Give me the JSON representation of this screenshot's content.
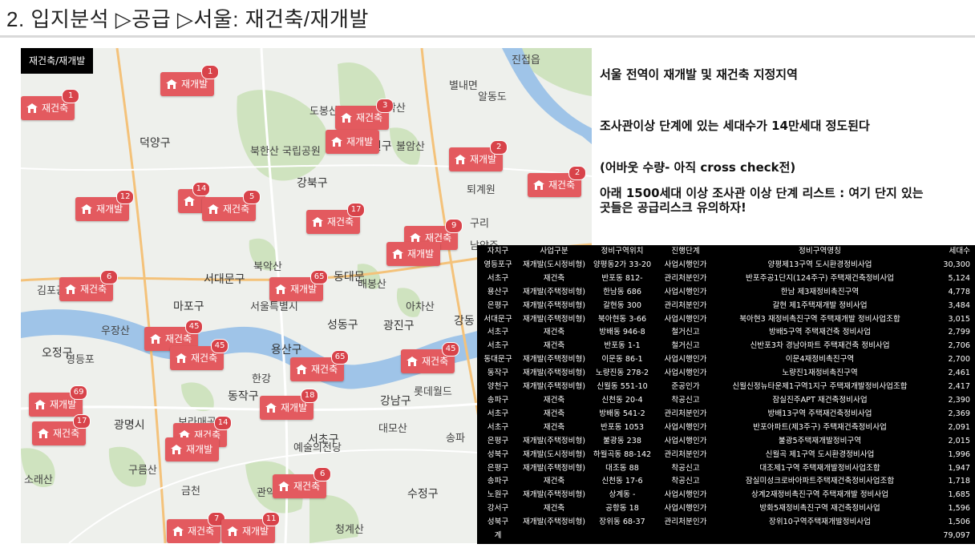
{
  "slide": {
    "title": "2. 입지분석 ▷공급 ▷서울: 재건축/재개발"
  },
  "map": {
    "label": "재건축/재개발",
    "districts": [
      {
        "name": "강북구",
        "cls": "big"
      },
      {
        "name": "노원구",
        "cls": "big"
      },
      {
        "name": "서대문구",
        "cls": "big"
      },
      {
        "name": "마포구",
        "cls": "big"
      },
      {
        "name": "성동구",
        "cls": "big"
      },
      {
        "name": "광진구",
        "cls": "big"
      },
      {
        "name": "용산구",
        "cls": "big"
      },
      {
        "name": "동작구",
        "cls": "big"
      },
      {
        "name": "강남구",
        "cls": "big"
      },
      {
        "name": "광명시",
        "cls": "big"
      },
      {
        "name": "오정구",
        "cls": "big"
      },
      {
        "name": "덕양구",
        "cls": "big"
      },
      {
        "name": "동대문",
        "cls": "big"
      },
      {
        "name": "서초구",
        "cls": "big"
      },
      {
        "name": "수정구",
        "cls": "big"
      },
      {
        "name": "강동",
        "cls": "big"
      },
      {
        "name": "북한산 국립공원",
        "cls": ""
      },
      {
        "name": "수락산",
        "cls": ""
      },
      {
        "name": "불암산",
        "cls": ""
      },
      {
        "name": "도봉산",
        "cls": ""
      },
      {
        "name": "별내면",
        "cls": ""
      },
      {
        "name": "진접읍",
        "cls": ""
      },
      {
        "name": "알동도",
        "cls": ""
      },
      {
        "name": "퇴계원",
        "cls": ""
      },
      {
        "name": "남양주",
        "cls": ""
      },
      {
        "name": "구리",
        "cls": ""
      },
      {
        "name": "아차산",
        "cls": ""
      },
      {
        "name": "배봉산",
        "cls": ""
      },
      {
        "name": "북악산",
        "cls": ""
      },
      {
        "name": "우장산",
        "cls": ""
      },
      {
        "name": "김포공",
        "cls": ""
      },
      {
        "name": "롯데월드",
        "cls": ""
      },
      {
        "name": "예술의전당",
        "cls": ""
      },
      {
        "name": "관악산",
        "cls": ""
      },
      {
        "name": "청계산",
        "cls": ""
      },
      {
        "name": "구름산",
        "cls": ""
      },
      {
        "name": "소래산",
        "cls": ""
      },
      {
        "name": "보라매공원",
        "cls": ""
      },
      {
        "name": "대모산",
        "cls": ""
      },
      {
        "name": "송파",
        "cls": ""
      },
      {
        "name": "서울특별시",
        "cls": ""
      },
      {
        "name": "한강",
        "cls": ""
      },
      {
        "name": "영등포",
        "cls": ""
      },
      {
        "name": "신림",
        "cls": ""
      },
      {
        "name": "금천",
        "cls": ""
      }
    ],
    "markers": [
      {
        "label": "재개발",
        "count": "1"
      },
      {
        "label": "재건축",
        "count": "1"
      },
      {
        "label": "재건축",
        "count": "3"
      },
      {
        "label": "재개발",
        "count": ""
      },
      {
        "label": "재개발",
        "count": "2"
      },
      {
        "label": "재건축",
        "count": "2"
      },
      {
        "label": "재개발",
        "count": "12"
      },
      {
        "label": "",
        "count": "14"
      },
      {
        "label": "재건축",
        "count": "5"
      },
      {
        "label": "재건축",
        "count": "17"
      },
      {
        "label": "재건축",
        "count": "9"
      },
      {
        "label": "재개발",
        "count": ""
      },
      {
        "label": "재건축",
        "count": "6"
      },
      {
        "label": "재개발",
        "count": "65"
      },
      {
        "label": "재건축",
        "count": "45"
      },
      {
        "label": "재건축",
        "count": "45"
      },
      {
        "label": "재건축",
        "count": "65"
      },
      {
        "label": "재건축",
        "count": "45"
      },
      {
        "label": "재개발",
        "count": "69"
      },
      {
        "label": "재건축",
        "count": "17"
      },
      {
        "label": "재개발",
        "count": "18"
      },
      {
        "label": "재건축",
        "count": "14"
      },
      {
        "label": "재개발",
        "count": ""
      },
      {
        "label": "재건축",
        "count": "6"
      },
      {
        "label": "재건축",
        "count": "7"
      },
      {
        "label": "재개발",
        "count": "11"
      }
    ],
    "colors": {
      "marker": "#e35a5f",
      "water": "#9fc4e8",
      "park": "#cfe3bf",
      "road": "#ffffff",
      "highway": "#f4c27a"
    }
  },
  "notes": [
    "서울 전역이 재개발 및 재건축 지정지역",
    "조사관이상 단계에 있는 세대수가 14만세대 정도된다",
    "(어바웃 수량- 아직 cross check전)",
    "아래 1500세대 이상 조사관 이상 단계 리스트 : 여기 단지 있는 곳들은 공급리스크 유의하자!"
  ],
  "table": {
    "headers": [
      "자치구",
      "사업구분",
      "정비구역위치",
      "진행단계",
      "정비구역명칭",
      "세대수"
    ],
    "rows": [
      [
        "영등포구",
        "재개발(도시정비형)",
        "양평동2가 33-20",
        "사업시행인가",
        "양평제13구역 도시환경정비사업",
        "30,300"
      ],
      [
        "서초구",
        "재건축",
        "반포동 812-",
        "관리처분인가",
        "반포주공1단지(124주구) 주택재건축정비사업",
        "5,124"
      ],
      [
        "용산구",
        "재개발(주택정비형)",
        "한남동 686",
        "사업시행인가",
        "한남 제3재정비촉진구역",
        "4,778"
      ],
      [
        "은평구",
        "재개발(주택정비형)",
        "갈현동 300",
        "관리처분인가",
        "갈현 제1주택재개발 정비사업",
        "3,484"
      ],
      [
        "서대문구",
        "재개발(주택정비형)",
        "북아현동 3-66",
        "사업시행인가",
        "북아현3 재정비촉진구역 주택재개발 정비사업조합",
        "3,015"
      ],
      [
        "서초구",
        "재건축",
        "방배동 946-8",
        "철거신고",
        "방배5구역 주택재건축 정비사업",
        "2,799"
      ],
      [
        "서초구",
        "재건축",
        "반포동 1-1",
        "철거신고",
        "신반포3차 경남아파트 주택재건축 정비사업",
        "2,706"
      ],
      [
        "동대문구",
        "재개발(주택정비형)",
        "이문동 86-1",
        "사업시행인가",
        "이문4재정비촉진구역",
        "2,700"
      ],
      [
        "동작구",
        "재개발(주택정비형)",
        "노량진동 278-2",
        "사업시행인가",
        "노량진1재정비촉진구역",
        "2,461"
      ],
      [
        "양천구",
        "재개발(주택정비형)",
        "신월동 551-10",
        "준공인가",
        "신월신정뉴타운제1구역1지구 주택재개발정비사업조합",
        "2,417"
      ],
      [
        "송파구",
        "재건축",
        "신천동 20-4",
        "착공신고",
        "잠실진주APT 재건축정비사업",
        "2,390"
      ],
      [
        "서초구",
        "재건축",
        "방배동 541-2",
        "관리처분인가",
        "방배13구역 주택재건축정비사업",
        "2,369"
      ],
      [
        "서초구",
        "재건축",
        "반포동 1053",
        "사업시행인가",
        "반포아파트(제3주구) 주택재건축정비사업",
        "2,091"
      ],
      [
        "은평구",
        "재개발(주택정비형)",
        "불광동 238",
        "사업시행인가",
        "불광5주택재개발정비구역",
        "2,015"
      ],
      [
        "성북구",
        "재개발(도시정비형)",
        "하월곡동 88-142",
        "관리처분인가",
        "신월곡 제1구역 도시환경정비사업",
        "1,996"
      ],
      [
        "은평구",
        "재개발(주택정비형)",
        "대조동 88",
        "착공신고",
        "대조제1구역 주택재개발정비사업조합",
        "1,947"
      ],
      [
        "송파구",
        "재건축",
        "신천동 17-6",
        "착공신고",
        "잠실미성크로바아파트주택재건축정비사업조합",
        "1,718"
      ],
      [
        "노원구",
        "재개발(주택정비형)",
        "상계동 -",
        "사업시행인가",
        "상계2재정비촉진구역 주택재개발 정비사업",
        "1,685"
      ],
      [
        "강서구",
        "재건축",
        "공항동 18",
        "사업시행인가",
        "방화5재정비촉진구역 재건축정비사업",
        "1,596"
      ],
      [
        "성북구",
        "재개발(주택정비형)",
        "장위동 68-37",
        "관리처분인가",
        "장위10구역주택재개발정비사업",
        "1,506"
      ],
      [
        "계",
        "",
        "",
        "",
        "",
        "79,097"
      ]
    ]
  }
}
